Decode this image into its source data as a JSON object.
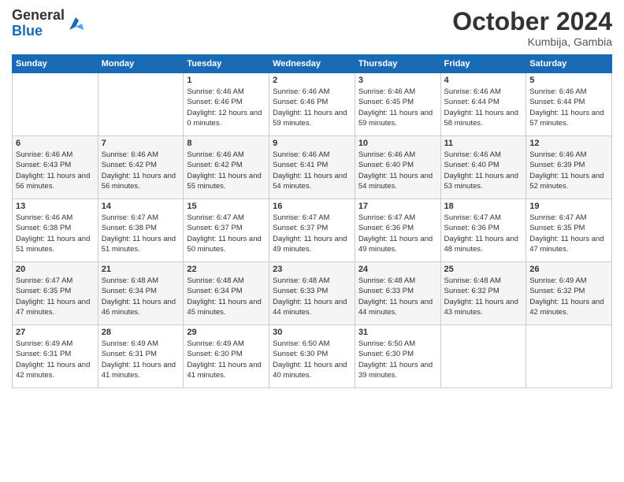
{
  "logo": {
    "general": "General",
    "blue": "Blue"
  },
  "header": {
    "month": "October 2024",
    "location": "Kumbija, Gambia"
  },
  "weekdays": [
    "Sunday",
    "Monday",
    "Tuesday",
    "Wednesday",
    "Thursday",
    "Friday",
    "Saturday"
  ],
  "weeks": [
    [
      {
        "day": "",
        "sunrise": "",
        "sunset": "",
        "daylight": ""
      },
      {
        "day": "",
        "sunrise": "",
        "sunset": "",
        "daylight": ""
      },
      {
        "day": "1",
        "sunrise": "Sunrise: 6:46 AM",
        "sunset": "Sunset: 6:46 PM",
        "daylight": "Daylight: 12 hours and 0 minutes."
      },
      {
        "day": "2",
        "sunrise": "Sunrise: 6:46 AM",
        "sunset": "Sunset: 6:46 PM",
        "daylight": "Daylight: 11 hours and 59 minutes."
      },
      {
        "day": "3",
        "sunrise": "Sunrise: 6:46 AM",
        "sunset": "Sunset: 6:45 PM",
        "daylight": "Daylight: 11 hours and 59 minutes."
      },
      {
        "day": "4",
        "sunrise": "Sunrise: 6:46 AM",
        "sunset": "Sunset: 6:44 PM",
        "daylight": "Daylight: 11 hours and 58 minutes."
      },
      {
        "day": "5",
        "sunrise": "Sunrise: 6:46 AM",
        "sunset": "Sunset: 6:44 PM",
        "daylight": "Daylight: 11 hours and 57 minutes."
      }
    ],
    [
      {
        "day": "6",
        "sunrise": "Sunrise: 6:46 AM",
        "sunset": "Sunset: 6:43 PM",
        "daylight": "Daylight: 11 hours and 56 minutes."
      },
      {
        "day": "7",
        "sunrise": "Sunrise: 6:46 AM",
        "sunset": "Sunset: 6:42 PM",
        "daylight": "Daylight: 11 hours and 56 minutes."
      },
      {
        "day": "8",
        "sunrise": "Sunrise: 6:46 AM",
        "sunset": "Sunset: 6:42 PM",
        "daylight": "Daylight: 11 hours and 55 minutes."
      },
      {
        "day": "9",
        "sunrise": "Sunrise: 6:46 AM",
        "sunset": "Sunset: 6:41 PM",
        "daylight": "Daylight: 11 hours and 54 minutes."
      },
      {
        "day": "10",
        "sunrise": "Sunrise: 6:46 AM",
        "sunset": "Sunset: 6:40 PM",
        "daylight": "Daylight: 11 hours and 54 minutes."
      },
      {
        "day": "11",
        "sunrise": "Sunrise: 6:46 AM",
        "sunset": "Sunset: 6:40 PM",
        "daylight": "Daylight: 11 hours and 53 minutes."
      },
      {
        "day": "12",
        "sunrise": "Sunrise: 6:46 AM",
        "sunset": "Sunset: 6:39 PM",
        "daylight": "Daylight: 11 hours and 52 minutes."
      }
    ],
    [
      {
        "day": "13",
        "sunrise": "Sunrise: 6:46 AM",
        "sunset": "Sunset: 6:38 PM",
        "daylight": "Daylight: 11 hours and 51 minutes."
      },
      {
        "day": "14",
        "sunrise": "Sunrise: 6:47 AM",
        "sunset": "Sunset: 6:38 PM",
        "daylight": "Daylight: 11 hours and 51 minutes."
      },
      {
        "day": "15",
        "sunrise": "Sunrise: 6:47 AM",
        "sunset": "Sunset: 6:37 PM",
        "daylight": "Daylight: 11 hours and 50 minutes."
      },
      {
        "day": "16",
        "sunrise": "Sunrise: 6:47 AM",
        "sunset": "Sunset: 6:37 PM",
        "daylight": "Daylight: 11 hours and 49 minutes."
      },
      {
        "day": "17",
        "sunrise": "Sunrise: 6:47 AM",
        "sunset": "Sunset: 6:36 PM",
        "daylight": "Daylight: 11 hours and 49 minutes."
      },
      {
        "day": "18",
        "sunrise": "Sunrise: 6:47 AM",
        "sunset": "Sunset: 6:36 PM",
        "daylight": "Daylight: 11 hours and 48 minutes."
      },
      {
        "day": "19",
        "sunrise": "Sunrise: 6:47 AM",
        "sunset": "Sunset: 6:35 PM",
        "daylight": "Daylight: 11 hours and 47 minutes."
      }
    ],
    [
      {
        "day": "20",
        "sunrise": "Sunrise: 6:47 AM",
        "sunset": "Sunset: 6:35 PM",
        "daylight": "Daylight: 11 hours and 47 minutes."
      },
      {
        "day": "21",
        "sunrise": "Sunrise: 6:48 AM",
        "sunset": "Sunset: 6:34 PM",
        "daylight": "Daylight: 11 hours and 46 minutes."
      },
      {
        "day": "22",
        "sunrise": "Sunrise: 6:48 AM",
        "sunset": "Sunset: 6:34 PM",
        "daylight": "Daylight: 11 hours and 45 minutes."
      },
      {
        "day": "23",
        "sunrise": "Sunrise: 6:48 AM",
        "sunset": "Sunset: 6:33 PM",
        "daylight": "Daylight: 11 hours and 44 minutes."
      },
      {
        "day": "24",
        "sunrise": "Sunrise: 6:48 AM",
        "sunset": "Sunset: 6:33 PM",
        "daylight": "Daylight: 11 hours and 44 minutes."
      },
      {
        "day": "25",
        "sunrise": "Sunrise: 6:48 AM",
        "sunset": "Sunset: 6:32 PM",
        "daylight": "Daylight: 11 hours and 43 minutes."
      },
      {
        "day": "26",
        "sunrise": "Sunrise: 6:49 AM",
        "sunset": "Sunset: 6:32 PM",
        "daylight": "Daylight: 11 hours and 42 minutes."
      }
    ],
    [
      {
        "day": "27",
        "sunrise": "Sunrise: 6:49 AM",
        "sunset": "Sunset: 6:31 PM",
        "daylight": "Daylight: 11 hours and 42 minutes."
      },
      {
        "day": "28",
        "sunrise": "Sunrise: 6:49 AM",
        "sunset": "Sunset: 6:31 PM",
        "daylight": "Daylight: 11 hours and 41 minutes."
      },
      {
        "day": "29",
        "sunrise": "Sunrise: 6:49 AM",
        "sunset": "Sunset: 6:30 PM",
        "daylight": "Daylight: 11 hours and 41 minutes."
      },
      {
        "day": "30",
        "sunrise": "Sunrise: 6:50 AM",
        "sunset": "Sunset: 6:30 PM",
        "daylight": "Daylight: 11 hours and 40 minutes."
      },
      {
        "day": "31",
        "sunrise": "Sunrise: 6:50 AM",
        "sunset": "Sunset: 6:30 PM",
        "daylight": "Daylight: 11 hours and 39 minutes."
      },
      {
        "day": "",
        "sunrise": "",
        "sunset": "",
        "daylight": ""
      },
      {
        "day": "",
        "sunrise": "",
        "sunset": "",
        "daylight": ""
      }
    ]
  ]
}
